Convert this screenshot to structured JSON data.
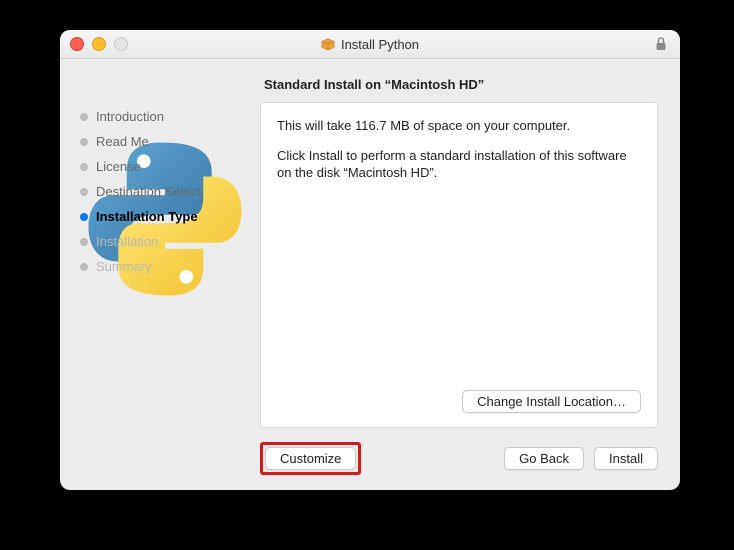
{
  "titlebar": {
    "title": "Install Python"
  },
  "sidebar": {
    "steps": [
      {
        "label": "Introduction",
        "state": "done"
      },
      {
        "label": "Read Me",
        "state": "done"
      },
      {
        "label": "License",
        "state": "done"
      },
      {
        "label": "Destination Select",
        "state": "done"
      },
      {
        "label": "Installation Type",
        "state": "active"
      },
      {
        "label": "Installation",
        "state": "future"
      },
      {
        "label": "Summary",
        "state": "future"
      }
    ]
  },
  "main": {
    "heading": "Standard Install on “Macintosh HD”",
    "line1": "This will take 116.7 MB of space on your computer.",
    "line2": "Click Install to perform a standard installation of this software on the disk “Macintosh HD”.",
    "change_location_label": "Change Install Location…"
  },
  "footer": {
    "customize_label": "Customize",
    "go_back_label": "Go Back",
    "install_label": "Install"
  }
}
